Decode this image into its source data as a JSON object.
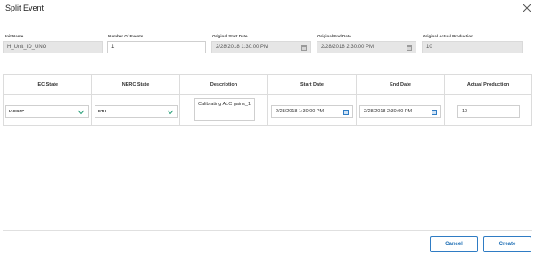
{
  "dialog": {
    "title": "Split Event"
  },
  "fields": {
    "unit_name": {
      "label": "Unit Name",
      "value": "H_Unit_ID_UNO"
    },
    "number_of_events": {
      "label": "Number Of Events",
      "value": "1"
    },
    "original_start_date": {
      "label": "Original Start Date",
      "value": "2/28/2018 1:30:00 PM"
    },
    "original_end_date": {
      "label": "Original End Date",
      "value": "2/28/2018 2:30:00 PM"
    },
    "original_actual_production": {
      "label": "Original Actual Production",
      "value": "10"
    }
  },
  "grid": {
    "headers": [
      "IEC State",
      "NERC State",
      "Description",
      "Start Date",
      "End Date",
      "Actual Production"
    ],
    "row": {
      "iec_state": "IAOGFP",
      "nerc_state": "ETH",
      "description": "Calibrating ALC gains_1",
      "start_date": "2/28/2018 1:30:00 PM",
      "end_date": "2/28/2018 2:30:00 PM",
      "actual_production": "10"
    }
  },
  "footer": {
    "cancel_label": "Cancel",
    "create_label": "Create"
  },
  "colors": {
    "accent": "#2f7cc4",
    "readonly_bg": "#e6e6e6",
    "border": "#cfcfcf"
  }
}
